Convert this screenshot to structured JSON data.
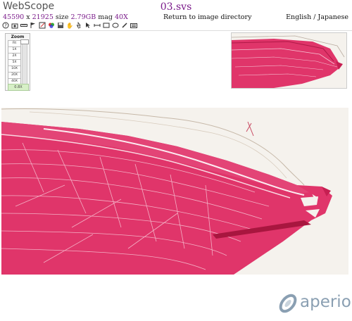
{
  "header": {
    "app_title": "WebScope",
    "file_name": "03.svs",
    "return_link": "Return to image directory",
    "lang_english": "English",
    "lang_sep": " / ",
    "lang_japanese": "Japanese"
  },
  "info": {
    "width": "45590",
    "x": " x ",
    "height": "21925",
    "size_label": " size ",
    "size": "2.79GB",
    "mag_label": " mag ",
    "mag": "40X"
  },
  "toolbar": {
    "icons": [
      "help-icon",
      "snapshot-icon",
      "ruler-icon",
      "flag-icon",
      "annotation-icon",
      "color-icon",
      "save-icon",
      "pan-hand-icon",
      "pointer-icon",
      "pointer-arrow-icon",
      "measure-icon",
      "rectangle-icon",
      "ellipse-icon",
      "pen-icon",
      "keyboard-icon"
    ]
  },
  "zoom": {
    "title": "Zoom",
    "levels": [
      "Fit",
      "1X",
      "2X",
      "5X",
      "10X",
      "20X",
      "40X"
    ],
    "current": "0.8X"
  },
  "logo": {
    "text": "aperio"
  },
  "colors": {
    "tissue": "#e0356a",
    "tissue_dark": "#c61f52",
    "background": "#f4f1ec",
    "accent": "#7a1a8a",
    "logo": "#8a9fb2"
  }
}
